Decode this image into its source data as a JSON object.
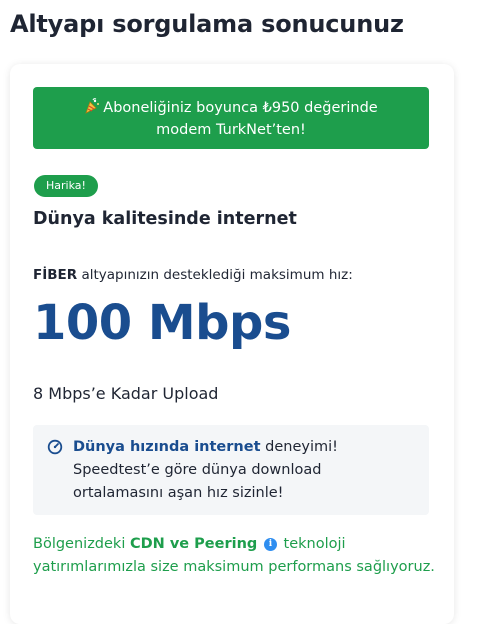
{
  "page": {
    "title": "Altyapı sorgulama sonucunuz"
  },
  "promo": {
    "icon": "party-popper-icon",
    "line1": "Aboneliğiniz boyunca ₺950 değerinde",
    "line2": "modem TurkNet’ten!",
    "color": "#1e9e4c"
  },
  "result": {
    "badge": "Harika!",
    "quality": "Dünya kalitesinde internet",
    "infra_type": "FİBER",
    "max_speed_label": "altyapınızın desteklediği maksimum hız:",
    "max_speed": "100 Mbps",
    "upload": "8 Mbps’e Kadar Upload",
    "speed_color": "#1a4d8f"
  },
  "info_box": {
    "icon": "speedometer-icon",
    "bold": "Dünya hızında internet",
    "text_part1": " deneyimi! Speedtest’e göre dünya download ortalamasını aşan hız sizinle!"
  },
  "cdn": {
    "prefix": "Bölgenizdeki ",
    "bold": "CDN ve Peering",
    "info_icon": "info-icon",
    "suffix": " teknoloji yatırımlarımızla size maksimum performans sağlıyoruz."
  }
}
